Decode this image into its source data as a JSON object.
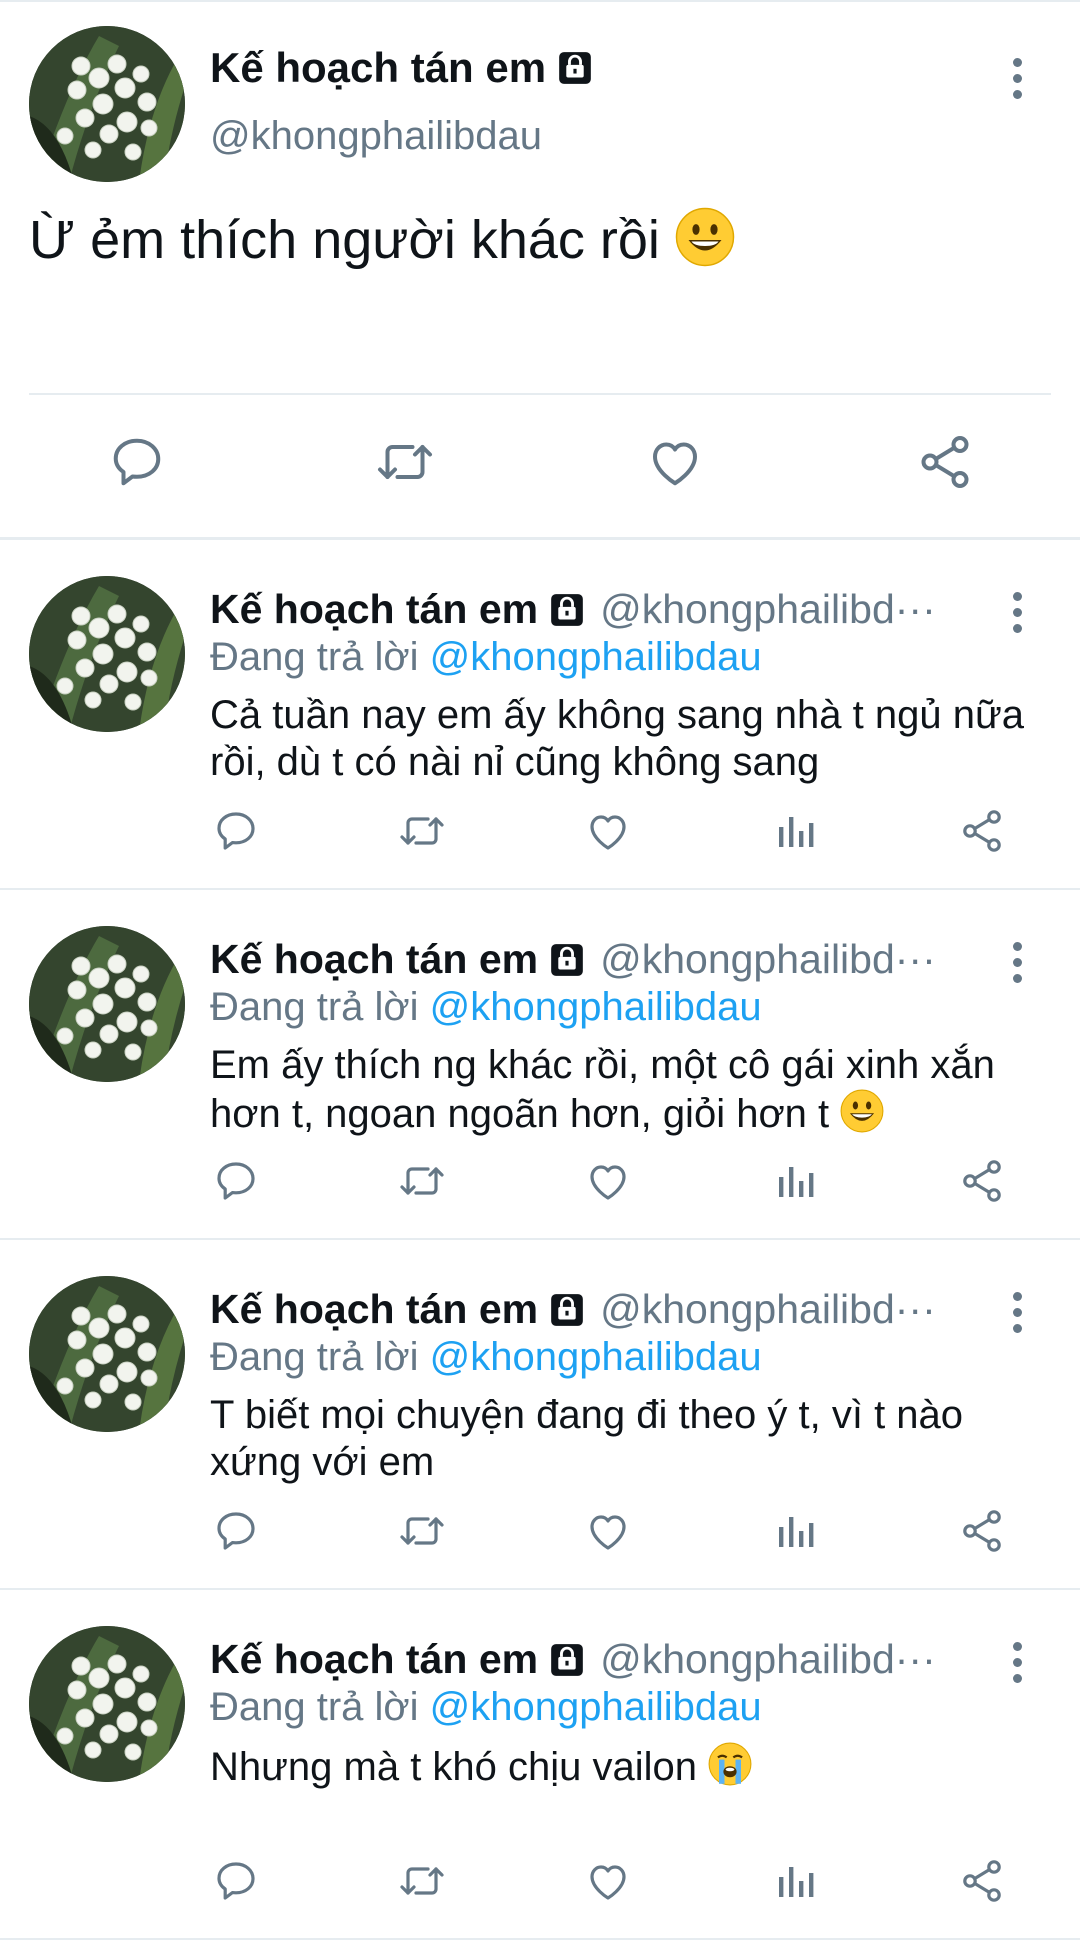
{
  "main_tweet": {
    "name": "Kế hoạch tán em",
    "handle": "@khongphailibdau",
    "text": "Ừ ẻm thích người khác rồi",
    "text_emoji": "grinning-face",
    "actions": [
      "reply-icon",
      "retweet-icon",
      "like-icon",
      "share-icon"
    ]
  },
  "replies": [
    {
      "name": "Kế hoạch tán em",
      "handle": "@khongphailibd···",
      "replying_label": "Đang trả lời",
      "replying_to": "@khongphailibdau",
      "text": "Cả tuần nay em ấy không sang nhà t ngủ nữa rồi, dù t có nài nỉ cũng không sang"
    },
    {
      "name": "Kế hoạch tán em",
      "handle": "@khongphailibd···",
      "replying_label": "Đang trả lời",
      "replying_to": "@khongphailibdau",
      "text": "Em ấy thích ng khác rồi, một cô gái xinh xắn hơn t, ngoan ngoãn hơn, giỏi hơn t",
      "text_emoji": "grinning-face"
    },
    {
      "name": "Kế hoạch tán em",
      "handle": "@khongphailibd···",
      "replying_label": "Đang trả lời",
      "replying_to": "@khongphailibdau",
      "text": "T biết mọi chuyện đang đi theo ý t, vì t nào xứng với em"
    },
    {
      "name": "Kế hoạch tán em",
      "handle": "@khongphailibd···",
      "replying_label": "Đang trả lời",
      "replying_to": "@khongphailibdau",
      "text": "Nhưng mà t khó chịu vailon",
      "text_emoji": "loudly-crying-face"
    }
  ],
  "colors": {
    "text": "#0f1419",
    "secondary": "#657786",
    "link": "#1da1f2",
    "divider": "#e6ecf0"
  }
}
